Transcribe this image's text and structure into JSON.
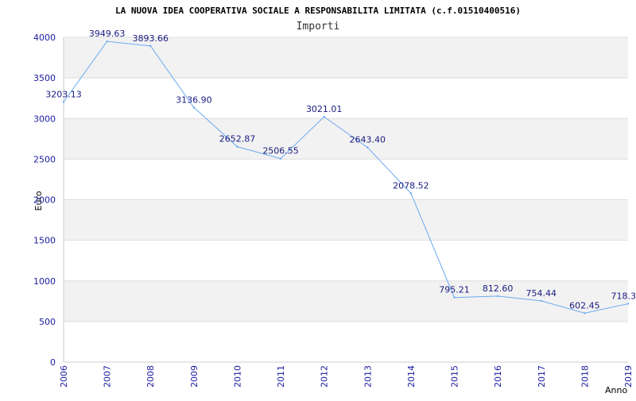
{
  "colors": {
    "line": "#6aaaf0",
    "band": "#f2f2f2",
    "grid": "#dddddd",
    "tick_text": "#1a1aa0",
    "label_text": "#1a1a80"
  },
  "chart_data": {
    "type": "line",
    "title": "LA NUOVA IDEA COOPERATIVA SOCIALE A RESPONSABILITA LIMITATA (c.f.01510400516)",
    "subtitle": "Importi",
    "xlabel": "Anno",
    "ylabel": "Euro",
    "ylim": [
      0,
      4000
    ],
    "yticks": [
      "0",
      "500",
      "1000",
      "1500",
      "2000",
      "2500",
      "3000",
      "3500",
      "4000"
    ],
    "categories": [
      "2006",
      "2007",
      "2008",
      "2009",
      "2010",
      "2011",
      "2012",
      "2013",
      "2014",
      "2015",
      "2016",
      "2017",
      "2018",
      "2019"
    ],
    "values": [
      3203.13,
      3949.63,
      3893.66,
      3136.9,
      2652.87,
      2506.55,
      3021.01,
      2643.4,
      2078.52,
      795.21,
      812.6,
      754.44,
      602.45,
      718.3
    ],
    "value_labels": [
      "3203.13",
      "3949.63",
      "3893.66",
      "3136.90",
      "2652.87",
      "2506.55",
      "3021.01",
      "2643.40",
      "2078.52",
      "795.21",
      "812.60",
      "754.44",
      "602.45",
      "718.3"
    ],
    "grid": true,
    "legend": "none"
  }
}
